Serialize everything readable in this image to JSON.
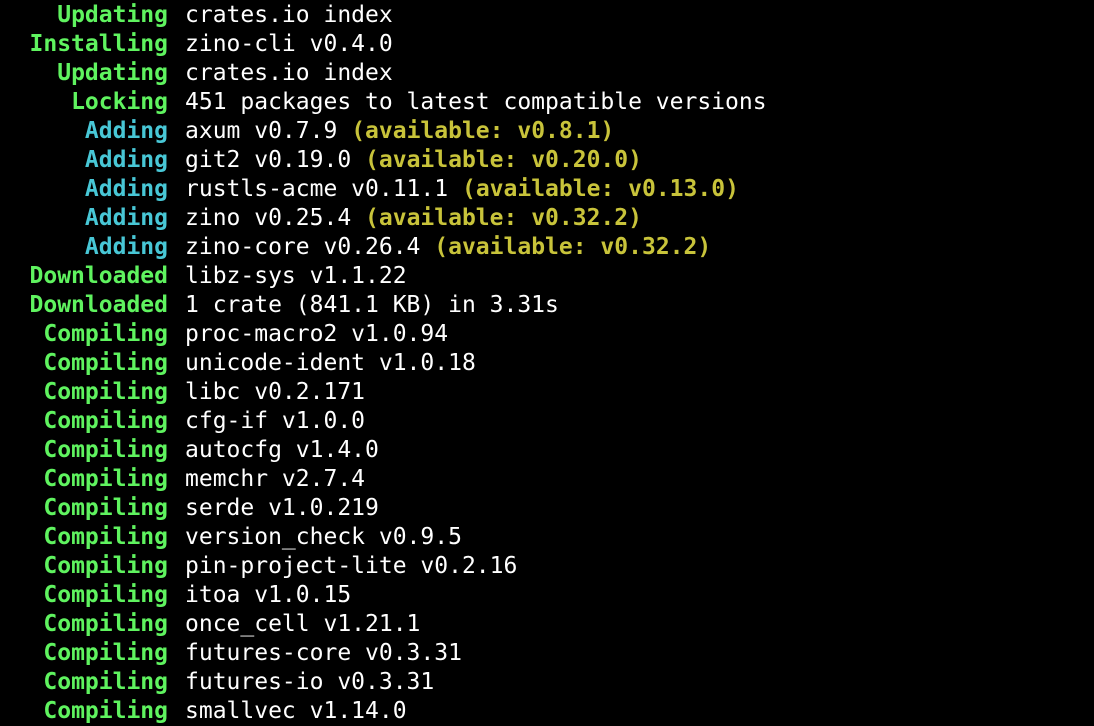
{
  "colors": {
    "background": "#000000",
    "text": "#ffffff",
    "status_green": "#5ff35f",
    "status_cyan": "#48c7d6",
    "available_yellow": "#c8c33a"
  },
  "lines": [
    {
      "status": "Updating",
      "color": "green",
      "message": "crates.io index",
      "available": ""
    },
    {
      "status": "Installing",
      "color": "green",
      "message": "zino-cli v0.4.0",
      "available": ""
    },
    {
      "status": "Updating",
      "color": "green",
      "message": "crates.io index",
      "available": ""
    },
    {
      "status": "Locking",
      "color": "green",
      "message": "451 packages to latest compatible versions",
      "available": ""
    },
    {
      "status": "Adding",
      "color": "cyan",
      "message": "axum v0.7.9",
      "available": "(available: v0.8.1)"
    },
    {
      "status": "Adding",
      "color": "cyan",
      "message": "git2 v0.19.0",
      "available": "(available: v0.20.0)"
    },
    {
      "status": "Adding",
      "color": "cyan",
      "message": "rustls-acme v0.11.1",
      "available": "(available: v0.13.0)"
    },
    {
      "status": "Adding",
      "color": "cyan",
      "message": "zino v0.25.4",
      "available": "(available: v0.32.2)"
    },
    {
      "status": "Adding",
      "color": "cyan",
      "message": "zino-core v0.26.4",
      "available": "(available: v0.32.2)"
    },
    {
      "status": "Downloaded",
      "color": "green",
      "message": "libz-sys v1.1.22",
      "available": ""
    },
    {
      "status": "Downloaded",
      "color": "green",
      "message": "1 crate (841.1 KB) in 3.31s",
      "available": ""
    },
    {
      "status": "Compiling",
      "color": "green",
      "message": "proc-macro2 v1.0.94",
      "available": ""
    },
    {
      "status": "Compiling",
      "color": "green",
      "message": "unicode-ident v1.0.18",
      "available": ""
    },
    {
      "status": "Compiling",
      "color": "green",
      "message": "libc v0.2.171",
      "available": ""
    },
    {
      "status": "Compiling",
      "color": "green",
      "message": "cfg-if v1.0.0",
      "available": ""
    },
    {
      "status": "Compiling",
      "color": "green",
      "message": "autocfg v1.4.0",
      "available": ""
    },
    {
      "status": "Compiling",
      "color": "green",
      "message": "memchr v2.7.4",
      "available": ""
    },
    {
      "status": "Compiling",
      "color": "green",
      "message": "serde v1.0.219",
      "available": ""
    },
    {
      "status": "Compiling",
      "color": "green",
      "message": "version_check v0.9.5",
      "available": ""
    },
    {
      "status": "Compiling",
      "color": "green",
      "message": "pin-project-lite v0.2.16",
      "available": ""
    },
    {
      "status": "Compiling",
      "color": "green",
      "message": "itoa v1.0.15",
      "available": ""
    },
    {
      "status": "Compiling",
      "color": "green",
      "message": "once_cell v1.21.1",
      "available": ""
    },
    {
      "status": "Compiling",
      "color": "green",
      "message": "futures-core v0.3.31",
      "available": ""
    },
    {
      "status": "Compiling",
      "color": "green",
      "message": "futures-io v0.3.31",
      "available": ""
    },
    {
      "status": "Compiling",
      "color": "green",
      "message": "smallvec v1.14.0",
      "available": ""
    }
  ]
}
